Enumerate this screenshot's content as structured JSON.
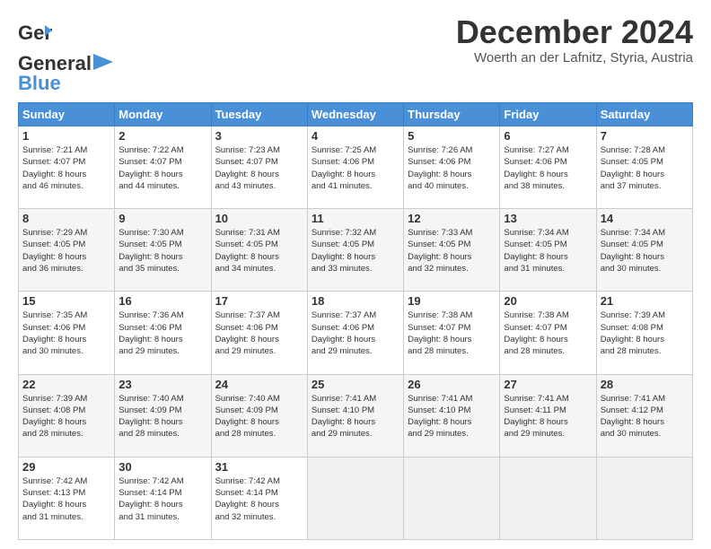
{
  "logo": {
    "line1": "General",
    "line2": "Blue"
  },
  "title": {
    "month": "December 2024",
    "location": "Woerth an der Lafnitz, Styria, Austria"
  },
  "days_of_week": [
    "Sunday",
    "Monday",
    "Tuesday",
    "Wednesday",
    "Thursday",
    "Friday",
    "Saturday"
  ],
  "weeks": [
    [
      {
        "day": 1,
        "lines": [
          "Sunrise: 7:21 AM",
          "Sunset: 4:07 PM",
          "Daylight: 8 hours",
          "and 46 minutes."
        ]
      },
      {
        "day": 2,
        "lines": [
          "Sunrise: 7:22 AM",
          "Sunset: 4:07 PM",
          "Daylight: 8 hours",
          "and 44 minutes."
        ]
      },
      {
        "day": 3,
        "lines": [
          "Sunrise: 7:23 AM",
          "Sunset: 4:07 PM",
          "Daylight: 8 hours",
          "and 43 minutes."
        ]
      },
      {
        "day": 4,
        "lines": [
          "Sunrise: 7:25 AM",
          "Sunset: 4:06 PM",
          "Daylight: 8 hours",
          "and 41 minutes."
        ]
      },
      {
        "day": 5,
        "lines": [
          "Sunrise: 7:26 AM",
          "Sunset: 4:06 PM",
          "Daylight: 8 hours",
          "and 40 minutes."
        ]
      },
      {
        "day": 6,
        "lines": [
          "Sunrise: 7:27 AM",
          "Sunset: 4:06 PM",
          "Daylight: 8 hours",
          "and 38 minutes."
        ]
      },
      {
        "day": 7,
        "lines": [
          "Sunrise: 7:28 AM",
          "Sunset: 4:05 PM",
          "Daylight: 8 hours",
          "and 37 minutes."
        ]
      }
    ],
    [
      {
        "day": 8,
        "lines": [
          "Sunrise: 7:29 AM",
          "Sunset: 4:05 PM",
          "Daylight: 8 hours",
          "and 36 minutes."
        ]
      },
      {
        "day": 9,
        "lines": [
          "Sunrise: 7:30 AM",
          "Sunset: 4:05 PM",
          "Daylight: 8 hours",
          "and 35 minutes."
        ]
      },
      {
        "day": 10,
        "lines": [
          "Sunrise: 7:31 AM",
          "Sunset: 4:05 PM",
          "Daylight: 8 hours",
          "and 34 minutes."
        ]
      },
      {
        "day": 11,
        "lines": [
          "Sunrise: 7:32 AM",
          "Sunset: 4:05 PM",
          "Daylight: 8 hours",
          "and 33 minutes."
        ]
      },
      {
        "day": 12,
        "lines": [
          "Sunrise: 7:33 AM",
          "Sunset: 4:05 PM",
          "Daylight: 8 hours",
          "and 32 minutes."
        ]
      },
      {
        "day": 13,
        "lines": [
          "Sunrise: 7:34 AM",
          "Sunset: 4:05 PM",
          "Daylight: 8 hours",
          "and 31 minutes."
        ]
      },
      {
        "day": 14,
        "lines": [
          "Sunrise: 7:34 AM",
          "Sunset: 4:05 PM",
          "Daylight: 8 hours",
          "and 30 minutes."
        ]
      }
    ],
    [
      {
        "day": 15,
        "lines": [
          "Sunrise: 7:35 AM",
          "Sunset: 4:06 PM",
          "Daylight: 8 hours",
          "and 30 minutes."
        ]
      },
      {
        "day": 16,
        "lines": [
          "Sunrise: 7:36 AM",
          "Sunset: 4:06 PM",
          "Daylight: 8 hours",
          "and 29 minutes."
        ]
      },
      {
        "day": 17,
        "lines": [
          "Sunrise: 7:37 AM",
          "Sunset: 4:06 PM",
          "Daylight: 8 hours",
          "and 29 minutes."
        ]
      },
      {
        "day": 18,
        "lines": [
          "Sunrise: 7:37 AM",
          "Sunset: 4:06 PM",
          "Daylight: 8 hours",
          "and 29 minutes."
        ]
      },
      {
        "day": 19,
        "lines": [
          "Sunrise: 7:38 AM",
          "Sunset: 4:07 PM",
          "Daylight: 8 hours",
          "and 28 minutes."
        ]
      },
      {
        "day": 20,
        "lines": [
          "Sunrise: 7:38 AM",
          "Sunset: 4:07 PM",
          "Daylight: 8 hours",
          "and 28 minutes."
        ]
      },
      {
        "day": 21,
        "lines": [
          "Sunrise: 7:39 AM",
          "Sunset: 4:08 PM",
          "Daylight: 8 hours",
          "and 28 minutes."
        ]
      }
    ],
    [
      {
        "day": 22,
        "lines": [
          "Sunrise: 7:39 AM",
          "Sunset: 4:08 PM",
          "Daylight: 8 hours",
          "and 28 minutes."
        ]
      },
      {
        "day": 23,
        "lines": [
          "Sunrise: 7:40 AM",
          "Sunset: 4:09 PM",
          "Daylight: 8 hours",
          "and 28 minutes."
        ]
      },
      {
        "day": 24,
        "lines": [
          "Sunrise: 7:40 AM",
          "Sunset: 4:09 PM",
          "Daylight: 8 hours",
          "and 28 minutes."
        ]
      },
      {
        "day": 25,
        "lines": [
          "Sunrise: 7:41 AM",
          "Sunset: 4:10 PM",
          "Daylight: 8 hours",
          "and 29 minutes."
        ]
      },
      {
        "day": 26,
        "lines": [
          "Sunrise: 7:41 AM",
          "Sunset: 4:10 PM",
          "Daylight: 8 hours",
          "and 29 minutes."
        ]
      },
      {
        "day": 27,
        "lines": [
          "Sunrise: 7:41 AM",
          "Sunset: 4:11 PM",
          "Daylight: 8 hours",
          "and 29 minutes."
        ]
      },
      {
        "day": 28,
        "lines": [
          "Sunrise: 7:41 AM",
          "Sunset: 4:12 PM",
          "Daylight: 8 hours",
          "and 30 minutes."
        ]
      }
    ],
    [
      {
        "day": 29,
        "lines": [
          "Sunrise: 7:42 AM",
          "Sunset: 4:13 PM",
          "Daylight: 8 hours",
          "and 31 minutes."
        ]
      },
      {
        "day": 30,
        "lines": [
          "Sunrise: 7:42 AM",
          "Sunset: 4:14 PM",
          "Daylight: 8 hours",
          "and 31 minutes."
        ]
      },
      {
        "day": 31,
        "lines": [
          "Sunrise: 7:42 AM",
          "Sunset: 4:14 PM",
          "Daylight: 8 hours",
          "and 32 minutes."
        ]
      },
      null,
      null,
      null,
      null
    ]
  ]
}
